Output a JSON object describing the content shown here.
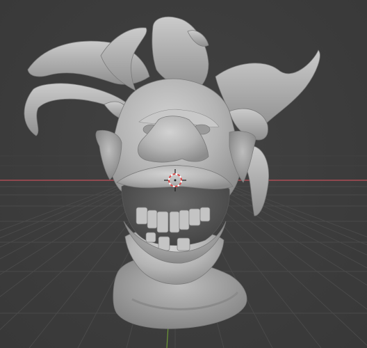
{
  "viewport": {
    "view": "3D Viewport",
    "shading": "solid",
    "background_color": "#3d3d3d",
    "grid_color": "#4a4a4a",
    "x_axis_color": "#c0505a",
    "y_axis_color": "#6e9a36",
    "mesh_color": "#b5b5b5",
    "objects": [
      {
        "name": "sculpted-creature-head",
        "icon": "mesh"
      }
    ],
    "cursor": {
      "icon": "3d-cursor-icon"
    }
  }
}
